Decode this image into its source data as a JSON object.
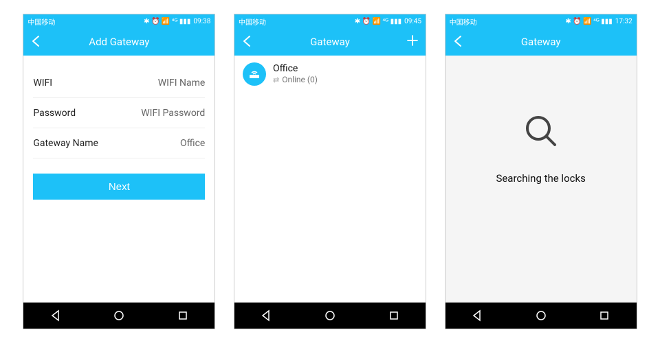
{
  "status": {
    "carrier": "中国移动",
    "icons": "✱ ⏰ 📶 ⁴ᴳ ▮▮▮",
    "time1": "09:38",
    "time2": "09:45",
    "time3": "17:32"
  },
  "screen1": {
    "title": "Add Gateway",
    "fields": {
      "wifi_label": "WIFI",
      "wifi_value": "WIFI Name",
      "password_label": "Password",
      "password_value": "WIFI Password",
      "gatewayname_label": "Gateway Name",
      "gatewayname_value": "Office"
    },
    "next_label": "Next"
  },
  "screen2": {
    "title": "Gateway",
    "item": {
      "name": "Office",
      "status": "Online (0)"
    }
  },
  "screen3": {
    "title": "Gateway",
    "message": "Searching the locks"
  }
}
